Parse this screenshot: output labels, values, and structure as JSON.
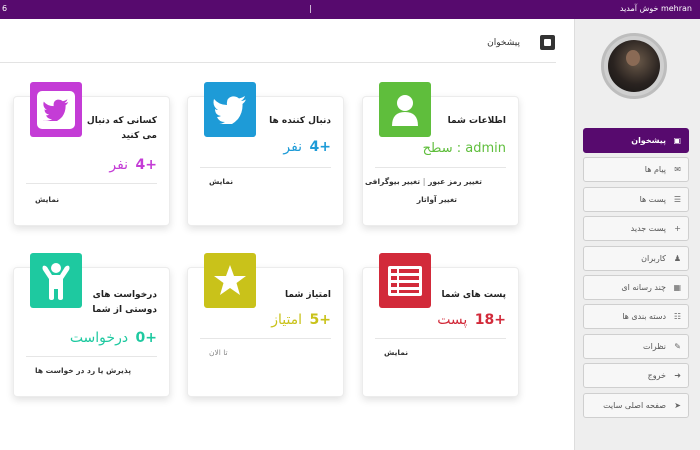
{
  "topbar": {
    "welcome": "خوش آمدید mehran",
    "left_number": "6",
    "separator": "|"
  },
  "header": {
    "title": "پیشخوان"
  },
  "sidebar": {
    "items": [
      {
        "label": "پیشخوان",
        "icon": "dashboard-icon"
      },
      {
        "label": "پیام ها",
        "icon": "envelope-icon"
      },
      {
        "label": "پست ها",
        "icon": "list-icon"
      },
      {
        "label": "پست جدید",
        "icon": "plus-icon"
      },
      {
        "label": "کاربران",
        "icon": "users-icon"
      },
      {
        "label": "چند رسانه ای",
        "icon": "image-icon"
      },
      {
        "label": "دسته بندی ها",
        "icon": "sitemap-icon"
      },
      {
        "label": "نظرات",
        "icon": "comments-icon"
      },
      {
        "label": "خروج",
        "icon": "logout-icon"
      },
      {
        "label": "صفحه اصلی سایت",
        "icon": "arrow-right-icon"
      }
    ]
  },
  "cards": {
    "info": {
      "title": "اطلاعات شما",
      "level": "سطح : admin",
      "link_password": "تغییر رمز عبور",
      "link_separator": "|",
      "link_bio": "تغییر بیوگرافی",
      "link_avatar": "تغییر آواتار",
      "color": "#5fbe3c"
    },
    "followers": {
      "title": "دنبال کننده ها",
      "count": "+4",
      "unit": "نفر",
      "link": "نمایش",
      "color": "#1e9bd7"
    },
    "following": {
      "title_line1": "کسانی که دنبال",
      "title_line2": "می کنید",
      "count": "+4",
      "unit": "نفر",
      "link": "نمایش",
      "color": "#c43cd6"
    },
    "posts": {
      "title": "پست های شما",
      "count": "+18",
      "unit": "پست",
      "link": "نمایش",
      "color": "#d22a3a"
    },
    "points": {
      "title": "امتیاز شما",
      "count": "+5",
      "unit": "امتیاز",
      "note": "تا الان",
      "color": "#c9c21a"
    },
    "requests": {
      "title_line1": "درخواست های",
      "title_line2": "دوستی از شما",
      "count": "+0",
      "unit": "درخواست",
      "link": "پذیرش یا رد در خواست ها",
      "color": "#1ec9a0"
    }
  }
}
